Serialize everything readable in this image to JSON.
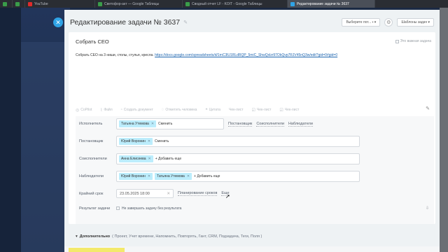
{
  "browser_tabs": [
    {
      "label": "",
      "color": "#3a9d4a"
    },
    {
      "label": "",
      "color": "#3a9d4a"
    },
    {
      "label": "YouTube",
      "color": "#e02b2b"
    },
    {
      "label": "Светофор-акт — Google Таблицы",
      "color": "#3a9d4a"
    },
    {
      "label": "Сводный отчет LF - KOIT - Google Таблицы",
      "color": "#3a9d4a"
    },
    {
      "label": "Редактирование задачи № 3637",
      "color": "#2fa3e6"
    }
  ],
  "modal": {
    "title": "Редактирование задачи № 3637",
    "select_label": "Выберите пот...",
    "templates_label": "Шаблоны задач"
  },
  "task": {
    "title": "Собрать СЕО",
    "important_label": "Это важная задача",
    "description_text": "Собрать СЕО на 3 ниши, столы,  стулья, кресла. ",
    "description_link": "https://docs.google.com/spreadsheets/d/1mC3lU1RLdRQP_5miC_ShwQxlzr97OkQvp7RJV45nQ3w/edit?gid=0#gid=0"
  },
  "toolbar": {
    "items": [
      "CoPilot",
      "Файл",
      "Создать документ",
      "Отметить человека",
      "Цитата",
      "Чек-лист",
      "Чек-лист",
      "Чек-лист"
    ]
  },
  "fields": {
    "executor": {
      "label": "Исполнитель",
      "chip": "Татьяна Утемова",
      "action": "Сменить",
      "links": [
        "Постановщик",
        "Соисполнители",
        "Наблюдатели"
      ]
    },
    "creator": {
      "label": "Постановщик",
      "chip": "Юрий Воронин",
      "action": "Сменить"
    },
    "coexecutors": {
      "label": "Соисполнители",
      "chip": "Анна Елисеева",
      "action": "+ Добавить еще"
    },
    "observers": {
      "label": "Наблюдатели",
      "chips": [
        "Юрий Воронин",
        "Татьяна Утемова"
      ],
      "action": "+ Добавить еще"
    },
    "deadline": {
      "label": "Крайний срок",
      "value": "23.05.2025 18:00",
      "links": [
        "Планирование сроков",
        "Еще"
      ]
    },
    "result": {
      "label": "Результат задачи",
      "checkbox_label": "Не завершать задачу без результата"
    }
  },
  "footer": {
    "label": "Дополнительно",
    "items": "( Проект,  Учет времени,  Напомнить,  Повторять,  Гант,  CRM,  Подзадача,  Теги,  Поля )"
  }
}
